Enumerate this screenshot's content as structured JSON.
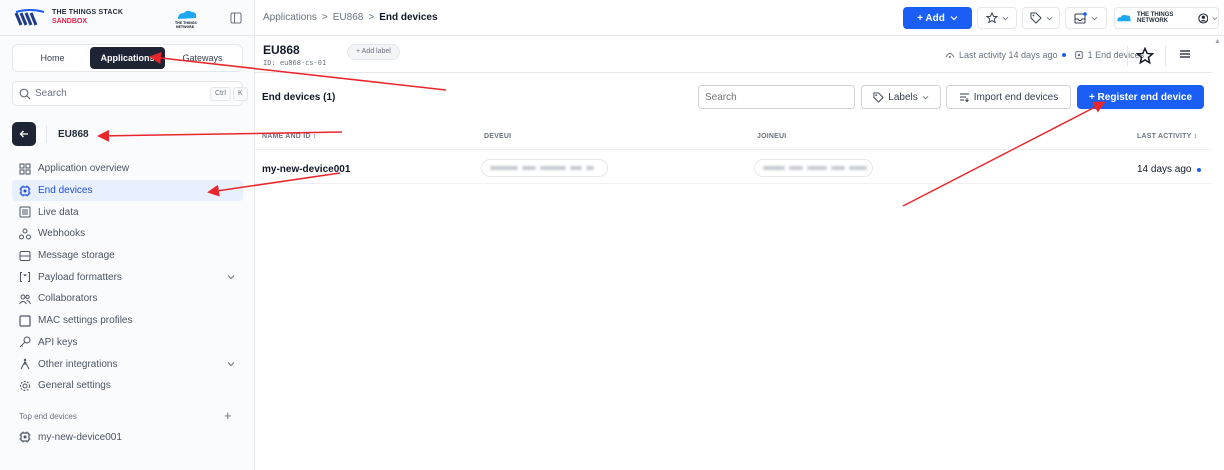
{
  "brand": {
    "line1": "THE THINGS STACK",
    "line2": "SANDBOX",
    "ttn_logo_text": "THE THINGS NETWORK"
  },
  "sidebar": {
    "tabs": [
      {
        "label": "Home",
        "active": false
      },
      {
        "label": "Applications",
        "active": true
      },
      {
        "label": "Gateways",
        "active": false
      }
    ],
    "search": {
      "placeholder": "Search",
      "kbd1": "Ctrl",
      "kbd2": "K"
    },
    "app_name": "EU868",
    "nav": [
      {
        "label": "Application overview",
        "icon": "grid-icon",
        "active": false
      },
      {
        "label": "End devices",
        "icon": "device-icon",
        "active": true
      },
      {
        "label": "Live data",
        "icon": "list-icon",
        "active": false
      },
      {
        "label": "Webhooks",
        "icon": "webhook-icon",
        "active": false
      },
      {
        "label": "Message storage",
        "icon": "storage-icon",
        "active": false
      },
      {
        "label": "Payload formatters",
        "icon": "code-icon",
        "active": false,
        "expandable": true
      },
      {
        "label": "Collaborators",
        "icon": "users-icon",
        "active": false
      },
      {
        "label": "MAC settings profiles",
        "icon": "square-icon",
        "active": false
      },
      {
        "label": "API keys",
        "icon": "key-icon",
        "active": false
      },
      {
        "label": "Other integrations",
        "icon": "integration-icon",
        "active": false,
        "expandable": true
      },
      {
        "label": "General settings",
        "icon": "gear-icon",
        "active": false
      }
    ],
    "top_devices_label": "Top end devices",
    "top_devices": [
      "my-new-device001"
    ]
  },
  "topbar": {
    "breadcrumb": [
      "Applications",
      "EU868",
      "End devices"
    ],
    "breadcrumb_sep": ">",
    "add_label": "+ Add"
  },
  "app_header": {
    "title": "EU868",
    "id": "ID: eu868-cs-01",
    "add_label_btn": "+ Add label",
    "last_activity": "Last activity 14 days ago",
    "end_devices_count": "1 End devices"
  },
  "toolbar": {
    "title": "End devices (1)",
    "search_placeholder": "Search",
    "labels_btn": "Labels",
    "import_btn": "Import end devices",
    "register_btn": "+ Register end device"
  },
  "table": {
    "headers": [
      "NAME AND ID ↕",
      "DEVEUI",
      "JOINEUI",
      "LAST ACTIVITY ↕"
    ],
    "rows": [
      {
        "name": "my-new-device001",
        "deveui": "(redacted)",
        "joineui": "(redacted)",
        "last_activity": "14 days ago"
      }
    ]
  },
  "colors": {
    "primary": "#1a5ef5",
    "dark": "#1e2433",
    "active_bg": "#e8effe",
    "annotation_red": "#e8262c"
  }
}
